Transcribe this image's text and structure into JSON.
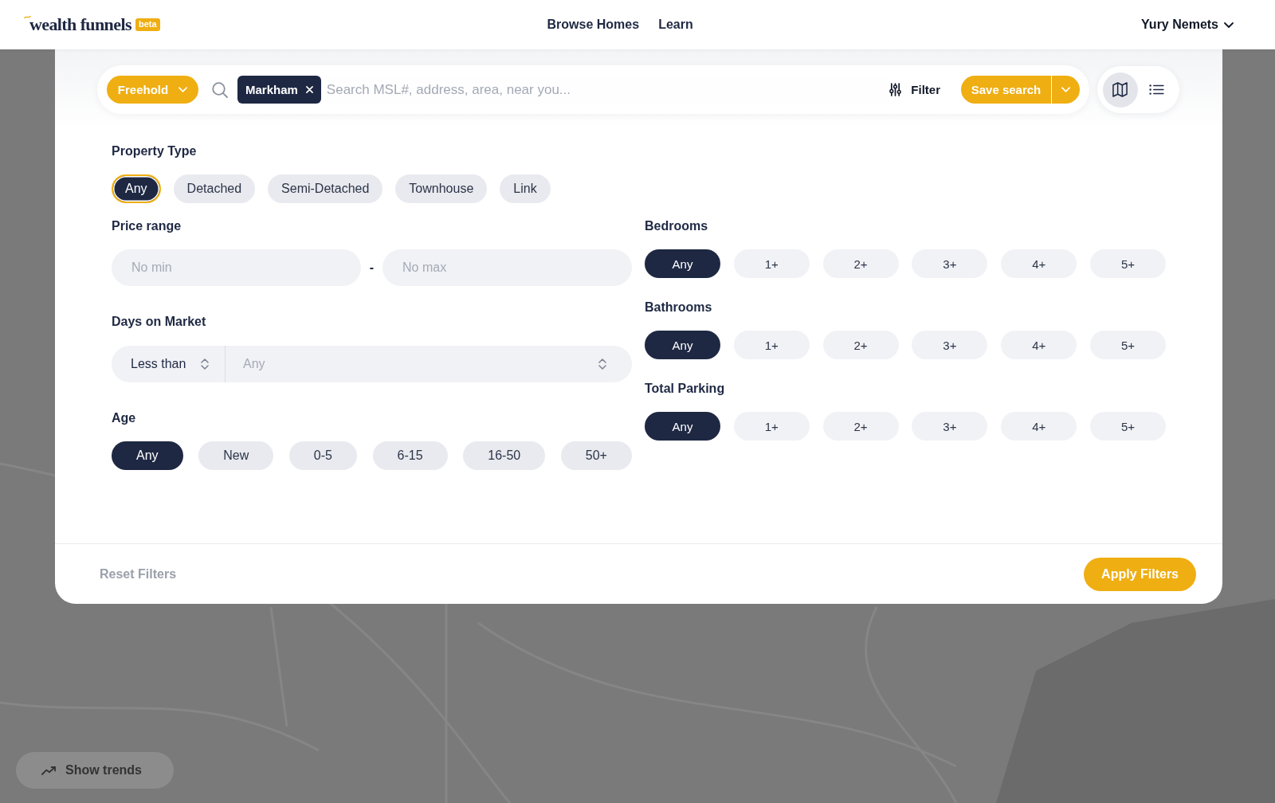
{
  "header": {
    "logo": "wealth funnels",
    "badge": "beta",
    "nav": [
      {
        "label": "Browse Homes"
      },
      {
        "label": "Learn"
      }
    ],
    "user": "Yury Nemets"
  },
  "search_bar": {
    "ownership": "Freehold",
    "chips": [
      {
        "label": "Markham"
      }
    ],
    "placeholder": "Search MSL#, address, area, near you...",
    "filter_button": "Filter",
    "save_button": "Save search"
  },
  "view_toggle": [
    {
      "kind": "map",
      "selected": true
    },
    {
      "kind": "list",
      "selected": false
    }
  ],
  "filters": {
    "property_type": {
      "label": "Property Type",
      "options": [
        {
          "label": "Any",
          "selected": true,
          "focused": true
        },
        {
          "label": "Detached",
          "selected": false,
          "focused": false
        },
        {
          "label": "Semi-Detached",
          "selected": false,
          "focused": false
        },
        {
          "label": "Townhouse",
          "selected": false,
          "focused": false
        },
        {
          "label": "Link",
          "selected": false,
          "focused": false
        }
      ]
    },
    "price_range": {
      "label": "Price range",
      "min": {
        "placeholder": "No min"
      },
      "separator": "-",
      "max": {
        "placeholder": "No max"
      }
    },
    "days_on_market": {
      "label": "Days on Market",
      "operator": "Less than",
      "value": {
        "placeholder": "Any"
      }
    },
    "age": {
      "label": "Age",
      "options": [
        {
          "label": "Any",
          "selected": true
        },
        {
          "label": "New",
          "selected": false
        },
        {
          "label": "0-5",
          "selected": false
        },
        {
          "label": "6-15",
          "selected": false
        },
        {
          "label": "16-50",
          "selected": false
        },
        {
          "label": "50+",
          "selected": false
        }
      ]
    },
    "bedrooms": {
      "label": "Bedrooms",
      "options": [
        {
          "label": "Any",
          "selected": true
        },
        {
          "label": "1+",
          "selected": false
        },
        {
          "label": "2+",
          "selected": false
        },
        {
          "label": "3+",
          "selected": false
        },
        {
          "label": "4+",
          "selected": false
        },
        {
          "label": "5+",
          "selected": false
        }
      ]
    },
    "bathrooms": {
      "label": "Bathrooms",
      "options": [
        {
          "label": "Any",
          "selected": true
        },
        {
          "label": "1+",
          "selected": false
        },
        {
          "label": "2+",
          "selected": false
        },
        {
          "label": "3+",
          "selected": false
        },
        {
          "label": "4+",
          "selected": false
        },
        {
          "label": "5+",
          "selected": false
        }
      ]
    },
    "total_parking": {
      "label": "Total Parking",
      "options": [
        {
          "label": "Any",
          "selected": true
        },
        {
          "label": "1+",
          "selected": false
        },
        {
          "label": "2+",
          "selected": false
        },
        {
          "label": "3+",
          "selected": false
        },
        {
          "label": "4+",
          "selected": false
        },
        {
          "label": "5+",
          "selected": false
        }
      ]
    }
  },
  "footer": {
    "reset": "Reset Filters",
    "apply": "Apply Filters"
  },
  "map": {
    "trends_button": "Show trends"
  }
}
